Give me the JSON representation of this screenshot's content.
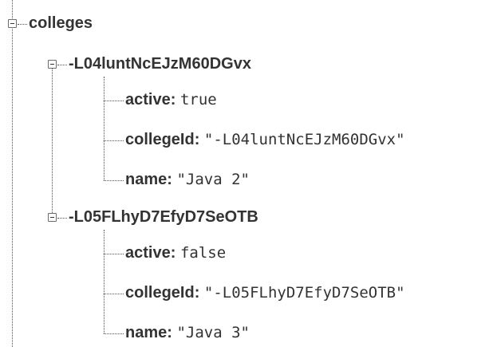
{
  "tree": {
    "root": {
      "key": "colleges",
      "children": [
        {
          "key": "-L04luntNcEJzM60DGvx",
          "fields": [
            {
              "key": "active:",
              "value": "true"
            },
            {
              "key": "collegeId:",
              "value": "\"-L04luntNcEJzM60DGvx\""
            },
            {
              "key": "name:",
              "value": "\"Java 2\""
            }
          ]
        },
        {
          "key": "-L05FLhyD7EfyD7SeOTB",
          "fields": [
            {
              "key": "active:",
              "value": "false"
            },
            {
              "key": "collegeId:",
              "value": "\"-L05FLhyD7EfyD7SeOTB\""
            },
            {
              "key": "name:",
              "value": "\"Java 3\""
            }
          ]
        }
      ]
    }
  }
}
